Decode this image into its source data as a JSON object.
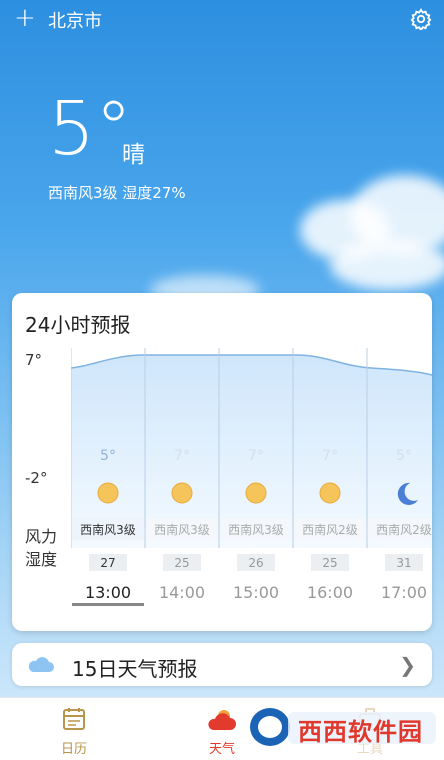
{
  "header": {
    "city": "北京市",
    "add_icon": "plus-icon",
    "settings_icon": "gear-icon"
  },
  "current": {
    "temperature": "5°",
    "condition": "晴",
    "wind_humidity": "西南风3级   湿度27%"
  },
  "hourly_card": {
    "title": "24小时预报",
    "y_max_label": "7°",
    "y_min_label": "-2°",
    "wind_row_label": "风力",
    "humidity_row_label": "湿度",
    "hours": [
      {
        "time": "13:00",
        "temp": "5°",
        "icon": "sun-icon",
        "wind": "西南风3级",
        "humidity": "27",
        "selected": true
      },
      {
        "time": "14:00",
        "temp": "7°",
        "icon": "sun-icon",
        "wind": "西南风3级",
        "humidity": "25",
        "selected": false
      },
      {
        "time": "15:00",
        "temp": "7°",
        "icon": "sun-icon",
        "wind": "西南风3级",
        "humidity": "26",
        "selected": false
      },
      {
        "time": "16:00",
        "temp": "7°",
        "icon": "sun-icon",
        "wind": "西南风2级",
        "humidity": "25",
        "selected": false
      },
      {
        "time": "17:00",
        "temp": "5°",
        "icon": "moon-icon",
        "wind": "西南风2级",
        "humidity": "31",
        "selected": false
      }
    ]
  },
  "forecast_button": {
    "label": "15日天气预报",
    "icon": "cloud-icon"
  },
  "tabs": [
    {
      "label": "日历",
      "icon": "calendar-icon"
    },
    {
      "label": "天气",
      "icon": "weather-icon"
    },
    {
      "label": "工具",
      "icon": "toolbox-icon"
    }
  ],
  "watermark": {
    "text": "西西软件园"
  },
  "colors": {
    "accent_tab": "#e23a2c",
    "inactive_tab": "#b8954a",
    "sky_top": "#2d8fe0"
  }
}
